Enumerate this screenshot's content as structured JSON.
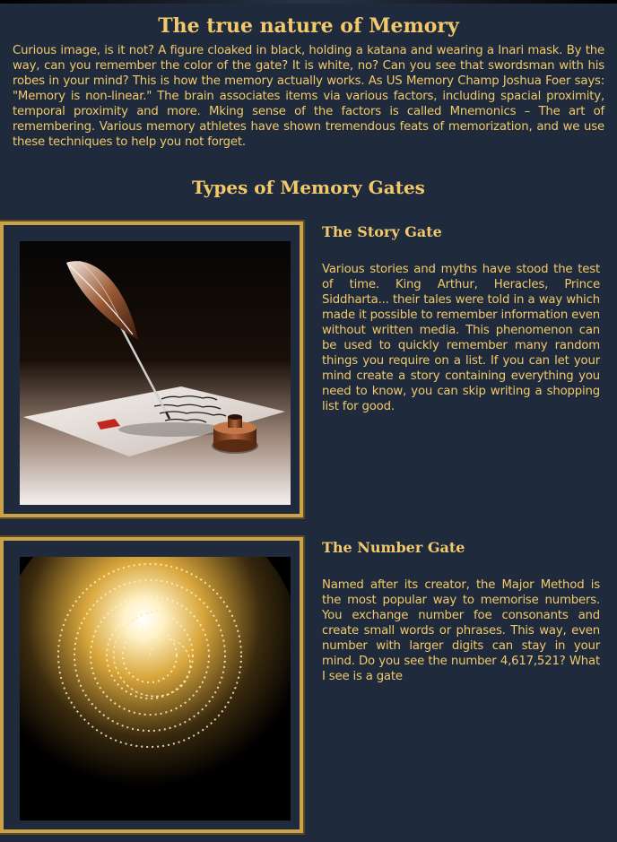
{
  "page": {
    "title": "The true nature of Memory",
    "intro": "Curious image, is it not? A figure cloaked in black, holding a katana and wearing a Inari mask. By the way, can you remember the color of the gate? It is white, no? Can you see that swordsman with his robes in your mind? This is how the memory actually works. As US Memory Champ Joshua Foer says: \"Memory is non-linear.\" The brain associates items via various factors, including spacial proximity, temporal proximity and more. Mking sense of the factors is called Mnemonics – The art of remembering. Various memory athletes have shown tremendous feats of memorization, and we use these techniques to help you not forget.",
    "section_title": "Types of Memory Gates"
  },
  "gates": [
    {
      "title": "The Story Gate",
      "description": "Various stories and myths have stood the test of time. King Arthur, Heracles, Prince Siddharta... their tales were told in a way which made it possible to remember information even without written media. This phenomenon can be used to quickly remember many random things you require on a list. If you can let your mind create a story containing everything you need to know, you can skip writing a shopping list for good.",
      "image_icon": "quill-pen-inkwell-image"
    },
    {
      "title": "The Number Gate",
      "description": "Named after its creator, the Major Method is the most popular way to memorise numbers. You exchange number foe consonants and create small words or phrases. This way, even number with larger digits can stay in your mind. Do you see the number 4,617,521? What I see is a gate",
      "image_icon": "number-spiral-light-image"
    }
  ],
  "colors": {
    "background": "#1f2a3c",
    "accent": "#f2c96a",
    "frame": "#c9a24a"
  }
}
